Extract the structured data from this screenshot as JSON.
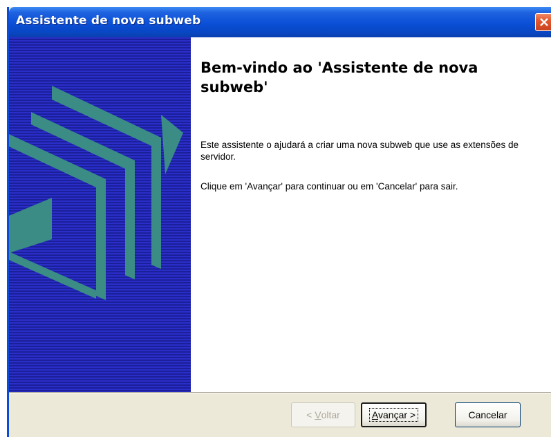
{
  "window": {
    "title": "Assistente de nova subweb"
  },
  "wizard": {
    "heading": "Bem-vindo ao 'Assistente de nova subweb'",
    "paragraph1": "Este assistente o ajudará a criar uma nova subweb que use as extensões de servidor.",
    "paragraph2": "Clique em 'Avançar' para continuar ou em 'Cancelar' para sair."
  },
  "buttons": {
    "back": {
      "prefix": "< ",
      "accel": "V",
      "rest": "oltar",
      "enabled": false
    },
    "next": {
      "accel": "A",
      "rest": "vançar >"
    },
    "cancel": "Cancelar"
  },
  "icons": {
    "close": "close-icon",
    "wizard_graphic": "wizard-pages-graphic"
  },
  "colors": {
    "title_bar": "#0a4fd6",
    "side_panel": "#2a2ec8",
    "graphic_teal": "#3a8c84",
    "close_button": "#e2582f"
  }
}
